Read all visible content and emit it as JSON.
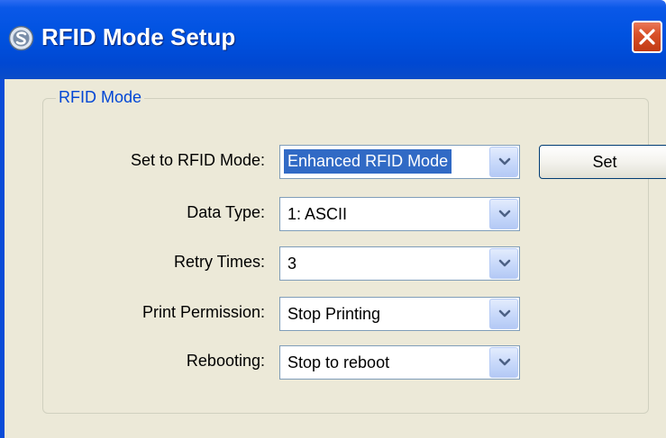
{
  "window": {
    "title": "RFID Mode Setup",
    "app_icon": "app-logo-icon",
    "close_icon": "close-icon"
  },
  "group": {
    "legend": "RFID Mode"
  },
  "fields": [
    {
      "label": "Set to RFID Mode:",
      "value": "Enhanced RFID Mode",
      "focused": true
    },
    {
      "label": "Data Type:",
      "value": "1: ASCII"
    },
    {
      "label": "Retry Times:",
      "value": "3"
    },
    {
      "label": "Print Permission:",
      "value": "Stop Printing"
    },
    {
      "label": "Rebooting:",
      "value": "Stop to reboot"
    }
  ],
  "set_button": {
    "label": "Set"
  },
  "colors": {
    "title_bar": "#0052e0",
    "close_button": "#d9512a",
    "group_legend": "#0046d5",
    "selection": "#316ac5",
    "dialog_background": "#ece9d8"
  }
}
